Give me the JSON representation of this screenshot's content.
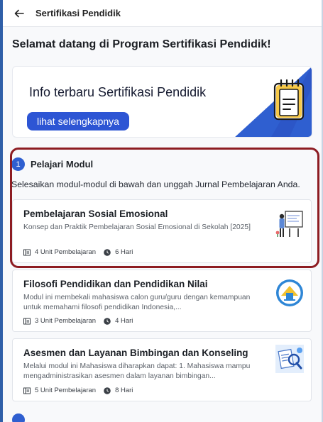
{
  "header": {
    "title": "Sertifikasi Pendidik"
  },
  "welcome": {
    "text": "Selamat datang di Program Sertifikasi Pendidik!"
  },
  "banner": {
    "title": "Info terbaru Sertifikasi Pendidik",
    "button_label": "lihat selengkapnya"
  },
  "step": {
    "number": "1",
    "title": "Pelajari Modul",
    "description": "Selesaikan modul-modul di bawah dan unggah Jurnal Pembelajaran Anda."
  },
  "modules": [
    {
      "title": "Pembelajaran Sosial Emosional",
      "description": "Konsep dan Praktik Pembelajaran Sosial Emosional di Sekolah [2025]",
      "units": "4 Unit Pembelajaran",
      "days": "6 Hari",
      "thumb_icon": "teacher-illustration-icon"
    },
    {
      "title": "Filosofi Pendidikan dan Pendidikan Nilai",
      "description": "Modul ini membekali mahasiswa calon guru/guru dengan kemampuan untuk memahami filosofi pendidikan Indonesia,...",
      "units": "3 Unit Pembelajaran",
      "days": "4 Hari",
      "thumb_icon": "tut-wuri-emblem-icon"
    },
    {
      "title": "Asesmen dan Layanan Bimbingan dan Konseling",
      "description": "Melalui modul ini Mahasiswa diharapkan dapat: 1. Mahasiswa mampu mengadministrasikan asesmen dalam layanan bimbingan...",
      "units": "5 Unit Pembelajaran",
      "days": "8 Hari",
      "thumb_icon": "assessment-illustration-icon"
    }
  ],
  "colors": {
    "accent": "#2d55d4",
    "highlight_border": "#8d1c22",
    "banner_corner": "#2f5fd0"
  }
}
